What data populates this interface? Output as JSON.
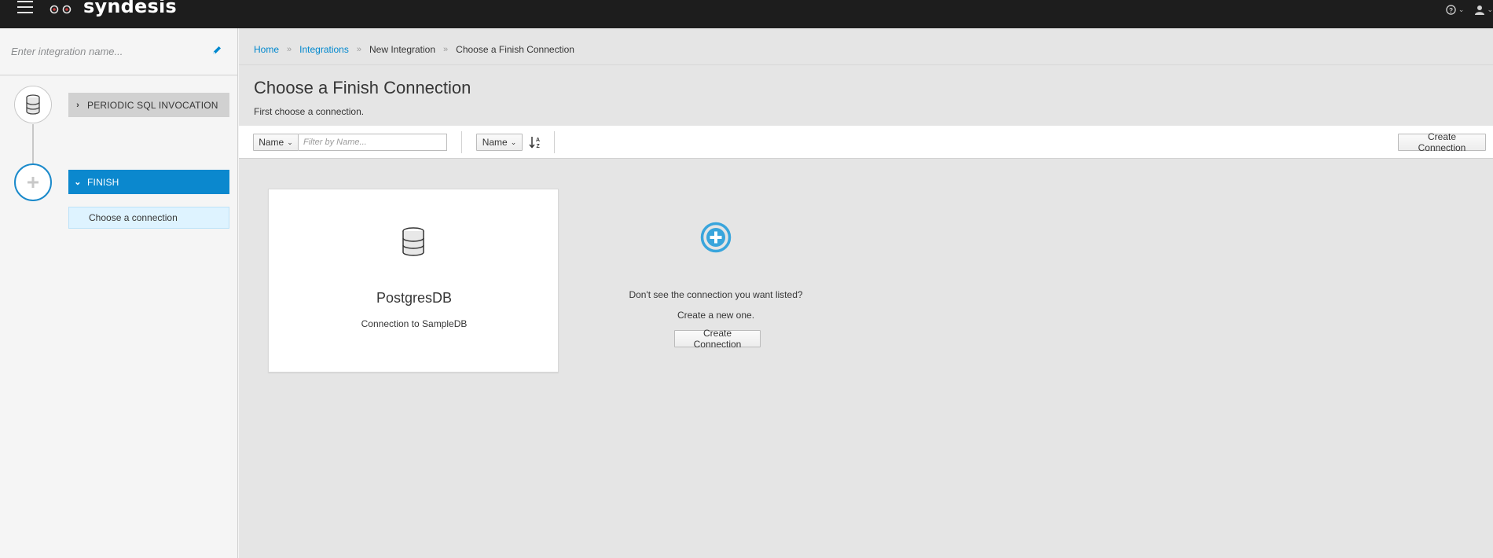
{
  "app": {
    "brand": "syndesis"
  },
  "header": {
    "icons": [
      "menu-icon",
      "syndesis-logo-icon",
      "help-icon",
      "user-icon"
    ]
  },
  "sidebar": {
    "name_placeholder": "Enter integration name...",
    "steps": [
      {
        "label": "PERIODIC SQL INVOCATION",
        "icon": "database-icon",
        "expanded": false
      },
      {
        "label": "FINISH",
        "icon": "plus-icon",
        "expanded": true,
        "sub_items": [
          "Choose a connection"
        ]
      }
    ]
  },
  "breadcrumb": {
    "items": [
      "Home",
      "Integrations",
      "New Integration",
      "Choose a Finish Connection"
    ]
  },
  "page": {
    "title": "Choose a Finish Connection",
    "subtitle": "First choose a connection."
  },
  "toolbar": {
    "filter_field": "Name",
    "filter_placeholder": "Filter by Name...",
    "sort_field": "Name",
    "create_label": "Create Connection"
  },
  "connections": [
    {
      "name": "PostgresDB",
      "description": "Connection to SampleDB",
      "icon": "database-icon"
    }
  ],
  "empty_state": {
    "line1": "Don't see the connection you want listed?",
    "line2": "Create a new one.",
    "button": "Create Connection"
  },
  "colors": {
    "accent": "#0088ce",
    "topbar": "#1d1d1d",
    "active_step": "#0b88ce"
  }
}
